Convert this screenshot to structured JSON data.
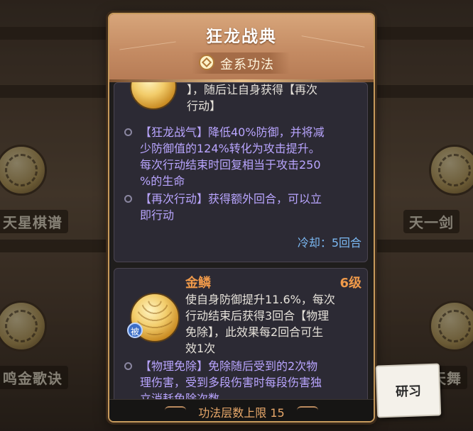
{
  "background": {
    "labels": [
      "天星棋谱",
      "天一剑",
      "鸣金歌诀",
      "天舞"
    ]
  },
  "panel": {
    "title": "狂龙战典",
    "subtitle": "金系功法",
    "subtitle_icon": "gold-element-icon"
  },
  "card1": {
    "desc_tail_line1": "】，随后让自身获得【再次",
    "desc_tail_line2": "行动】",
    "effects": [
      {
        "lines": [
          "【狂龙战气】降低40%防御，并将减",
          "少防御值的124%转化为攻击提升。",
          "每次行动结束时回复相当于攻击250",
          "%的生命"
        ]
      },
      {
        "lines": [
          "【再次行动】获得额外回合，可以立",
          "即行动"
        ]
      }
    ],
    "cooldown": "冷却：5回合"
  },
  "card2": {
    "name": "金鳞",
    "level": "6级",
    "badge": "被",
    "desc_lines": [
      "使自身防御提升11.6%，每次",
      "行动结束后获得3回合【物理",
      "免除】，此效果每2回合可生",
      "效1次"
    ],
    "effect_lines": [
      "【物理免除】免除随后受到的2次物",
      "理伤害，受到多段伤害时每段伤害独",
      "立消耗免除次数"
    ]
  },
  "footer": {
    "text": "功法层数上限 15"
  },
  "research_button": {
    "label": "研习"
  },
  "colors": {
    "panel_border": "#c79a5c",
    "header": "#c48b63",
    "effect_text": "#b9a5ff",
    "cooldown": "#7bb8f2",
    "skill_accent": "#f09a4a"
  }
}
